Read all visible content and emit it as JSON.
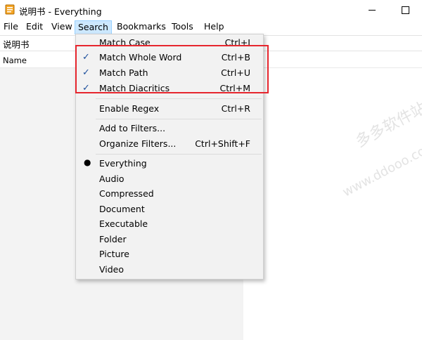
{
  "window": {
    "title": "说明书 - Everything",
    "minimize_glyph": "",
    "maximize_glyph": ""
  },
  "menubar": {
    "items": [
      "File",
      "Edit",
      "View",
      "Search",
      "Bookmarks",
      "Tools",
      "Help"
    ],
    "active": "Search"
  },
  "search": {
    "value": "说明书"
  },
  "list": {
    "columns": [
      "Name"
    ]
  },
  "watermark": {
    "text_cn": "多多软件站",
    "text_url": "www.ddooo.com"
  },
  "search_menu": {
    "items": [
      {
        "label": "Match Case",
        "shortcut": "Ctrl+I",
        "checked": false
      },
      {
        "label": "Match Whole Word",
        "shortcut": "Ctrl+B",
        "checked": true
      },
      {
        "label": "Match Path",
        "shortcut": "Ctrl+U",
        "checked": true
      },
      {
        "label": "Match Diacritics",
        "shortcut": "Ctrl+M",
        "checked": true
      },
      {
        "label": "Enable Regex",
        "shortcut": "Ctrl+R",
        "checked": false
      },
      {
        "label": "Add to Filters...",
        "shortcut": "",
        "checked": false
      },
      {
        "label": "Organize Filters...",
        "shortcut": "Ctrl+Shift+F",
        "checked": false
      },
      {
        "label": "Everything",
        "shortcut": "",
        "selected": true
      },
      {
        "label": "Audio",
        "shortcut": "",
        "selected": false
      },
      {
        "label": "Compressed",
        "shortcut": "",
        "selected": false
      },
      {
        "label": "Document",
        "shortcut": "",
        "selected": false
      },
      {
        "label": "Executable",
        "shortcut": "",
        "selected": false
      },
      {
        "label": "Folder",
        "shortcut": "",
        "selected": false
      },
      {
        "label": "Picture",
        "shortcut": "",
        "selected": false
      },
      {
        "label": "Video",
        "shortcut": "",
        "selected": false
      }
    ],
    "check_glyph": "✓",
    "bullet_glyph": "●"
  },
  "colors": {
    "menu_active_bg": "#cce8ff",
    "highlight_border": "#e6262e",
    "check_color": "#1c4f9c"
  }
}
